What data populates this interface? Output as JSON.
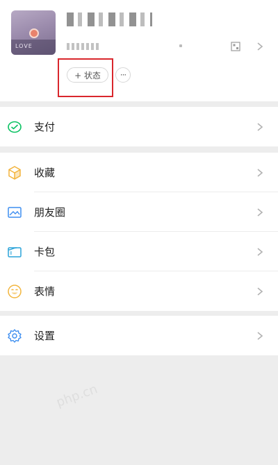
{
  "profile": {
    "avatar_text": "LOVE",
    "status_button_label": "+ 状态",
    "more_button_label": "···"
  },
  "menu_groups": [
    {
      "items": [
        {
          "label": "支付",
          "icon": "wechat-pay-icon",
          "icon_color": "#07c160"
        }
      ]
    },
    {
      "items": [
        {
          "label": "收藏",
          "icon": "favorites-cube-icon",
          "icon_color": "#f3b43d"
        },
        {
          "label": "朋友圈",
          "icon": "moments-photo-icon",
          "icon_color": "#3d8ef0"
        },
        {
          "label": "卡包",
          "icon": "card-wallet-icon",
          "icon_color": "#2aa3d9"
        },
        {
          "label": "表情",
          "icon": "sticker-smiley-icon",
          "icon_color": "#f2b53d"
        }
      ]
    },
    {
      "items": [
        {
          "label": "设置",
          "icon": "settings-gear-icon",
          "icon_color": "#3d8ef0"
        }
      ]
    }
  ],
  "watermark": "php.cn",
  "colors": {
    "background": "#ededed",
    "card": "#ffffff",
    "highlight": "#d9262c"
  }
}
